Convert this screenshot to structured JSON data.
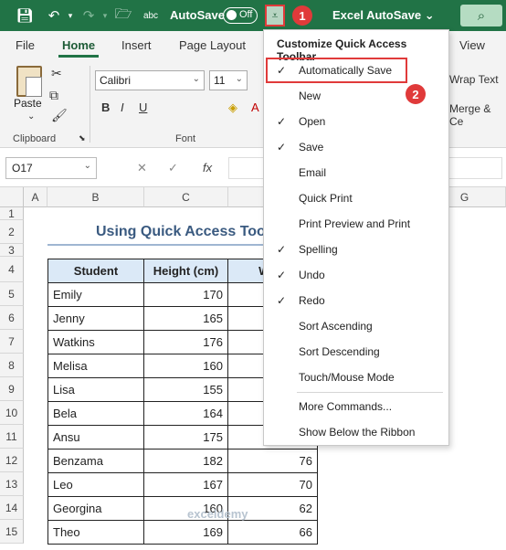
{
  "titlebar": {
    "autosave_label": "AutoSave",
    "autosave_state": "Off",
    "workbook_title": "Excel AutoSave",
    "badge1": "1",
    "badge2": "2"
  },
  "tabs": [
    "File",
    "Home",
    "Insert",
    "Page Layout",
    "View"
  ],
  "ribbon": {
    "paste_label": "Paste",
    "clipboard_label": "Clipboard",
    "font_label": "Font",
    "font_name": "Calibri",
    "font_size": "11",
    "bold": "B",
    "italic": "I",
    "underline": "U",
    "wrap_text": "Wrap Text",
    "merge_center": "Merge & Ce"
  },
  "formula_bar": {
    "name_box": "O17",
    "fx": "fx"
  },
  "columns": [
    "A",
    "B",
    "C",
    "G"
  ],
  "rows": [
    "1",
    "2",
    "3",
    "4",
    "5",
    "6",
    "7",
    "8",
    "9",
    "10",
    "11",
    "12",
    "13",
    "14",
    "15"
  ],
  "sheet": {
    "title": "Using Quick Access Too",
    "headers": [
      "Student",
      "Height (cm)",
      "Weig"
    ],
    "data": [
      {
        "name": "Emily",
        "height": "170",
        "weight": ""
      },
      {
        "name": "Jenny",
        "height": "165",
        "weight": ""
      },
      {
        "name": "Watkins",
        "height": "176",
        "weight": ""
      },
      {
        "name": "Melisa",
        "height": "160",
        "weight": ""
      },
      {
        "name": "Lisa",
        "height": "155",
        "weight": ""
      },
      {
        "name": "Bela",
        "height": "164",
        "weight": ""
      },
      {
        "name": "Ansu",
        "height": "175",
        "weight": ""
      },
      {
        "name": "Benzama",
        "height": "182",
        "weight": "76"
      },
      {
        "name": "Leo",
        "height": "167",
        "weight": "70"
      },
      {
        "name": "Georgina",
        "height": "160",
        "weight": "62"
      },
      {
        "name": "Theo",
        "height": "169",
        "weight": "66"
      }
    ]
  },
  "menu": {
    "title": "Customize Quick Access Toolbar",
    "items": [
      {
        "label": "Automatically Save",
        "checked": "✓"
      },
      {
        "label": "New",
        "checked": ""
      },
      {
        "label": "Open",
        "checked": "✓"
      },
      {
        "label": "Save",
        "checked": "✓"
      },
      {
        "label": "Email",
        "checked": ""
      },
      {
        "label": "Quick Print",
        "checked": ""
      },
      {
        "label": "Print Preview and Print",
        "checked": ""
      },
      {
        "label": "Spelling",
        "checked": "✓"
      },
      {
        "label": "Undo",
        "checked": "✓"
      },
      {
        "label": "Redo",
        "checked": "✓"
      },
      {
        "label": "Sort Ascending",
        "checked": ""
      },
      {
        "label": "Sort Descending",
        "checked": ""
      },
      {
        "label": "Touch/Mouse Mode",
        "checked": ""
      },
      {
        "label": "More Commands...",
        "checked": ""
      },
      {
        "label": "Show Below the Ribbon",
        "checked": ""
      }
    ]
  },
  "watermark": "exceldemy",
  "colors": {
    "excel_green": "#217346",
    "highlight_red": "#e03a3a",
    "header_fill": "#dbe9f7"
  }
}
